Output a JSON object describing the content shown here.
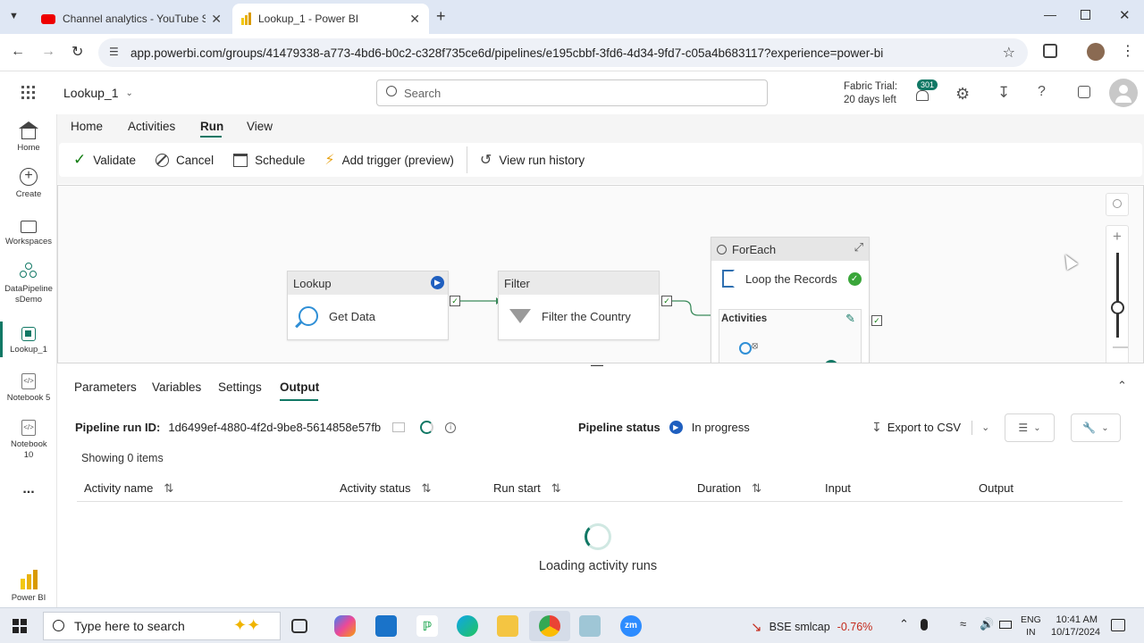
{
  "browser": {
    "tabs": [
      {
        "title": "Channel analytics - YouTube Stu",
        "icon": "youtube-icon",
        "active": false
      },
      {
        "title": "Lookup_1 - Power BI",
        "icon": "powerbi-icon",
        "active": true
      }
    ],
    "url": "app.powerbi.com/groups/41479338-a773-4bd6-b0c2-c328f735ce6d/pipelines/e195cbbf-3fd6-4d34-9fd7-c05a4b683117?experience=power-bi"
  },
  "header": {
    "item_name": "Lookup_1",
    "search_placeholder": "Search",
    "trial_line1": "Fabric Trial:",
    "trial_line2": "20 days left",
    "notification_count": "301"
  },
  "rail": {
    "items": [
      {
        "label": "Home",
        "icon": "home-icon"
      },
      {
        "label": "Create",
        "icon": "create-icon"
      },
      {
        "label": "Workspaces",
        "icon": "workspaces-icon"
      },
      {
        "label": "DataPipeline sDemo",
        "icon": "workspace-icon"
      },
      {
        "label": "Lookup_1",
        "icon": "pipeline-icon"
      },
      {
        "label": "Notebook 5",
        "icon": "notebook-icon"
      },
      {
        "label": "Notebook 10",
        "icon": "notebook-icon"
      },
      {
        "label": "...",
        "icon": "more-icon"
      },
      {
        "label": "Power BI",
        "icon": "powerbi-icon"
      }
    ]
  },
  "ribbon": {
    "tabs": [
      "Home",
      "Activities",
      "Run",
      "View"
    ],
    "selected_tab": "Run",
    "commands": [
      "Validate",
      "Cancel",
      "Schedule",
      "Add trigger (preview)",
      "View run history"
    ]
  },
  "canvas": {
    "lookup": {
      "type": "Lookup",
      "name": "Get Data"
    },
    "filter": {
      "type": "Filter",
      "name": "Filter the Country"
    },
    "foreach": {
      "type": "ForEach",
      "name": "Loop the Records",
      "activities_label": "Activities"
    }
  },
  "panel": {
    "tabs": [
      "Parameters",
      "Variables",
      "Settings",
      "Output"
    ],
    "selected_tab": "Output",
    "run_id_label": "Pipeline run ID:",
    "run_id": "1d6499ef-4880-4f2d-9be8-5614858e57fb",
    "status_label": "Pipeline status",
    "status": "In progress",
    "export_label": "Export to CSV",
    "showing": "Showing 0 items",
    "columns": [
      "Activity name",
      "Activity status",
      "Run start",
      "Duration",
      "Input",
      "Output"
    ],
    "loading": "Loading activity runs"
  },
  "taskbar": {
    "search_placeholder": "Type here to search",
    "stock_name": "BSE smlcap",
    "stock_change": "-0.76%",
    "lang1": "ENG",
    "lang2": "IN",
    "time": "10:41 AM",
    "date": "10/17/2024"
  },
  "colors": {
    "accent": "#117865",
    "stock_down": "#c42b1c",
    "check": "#107c10"
  }
}
